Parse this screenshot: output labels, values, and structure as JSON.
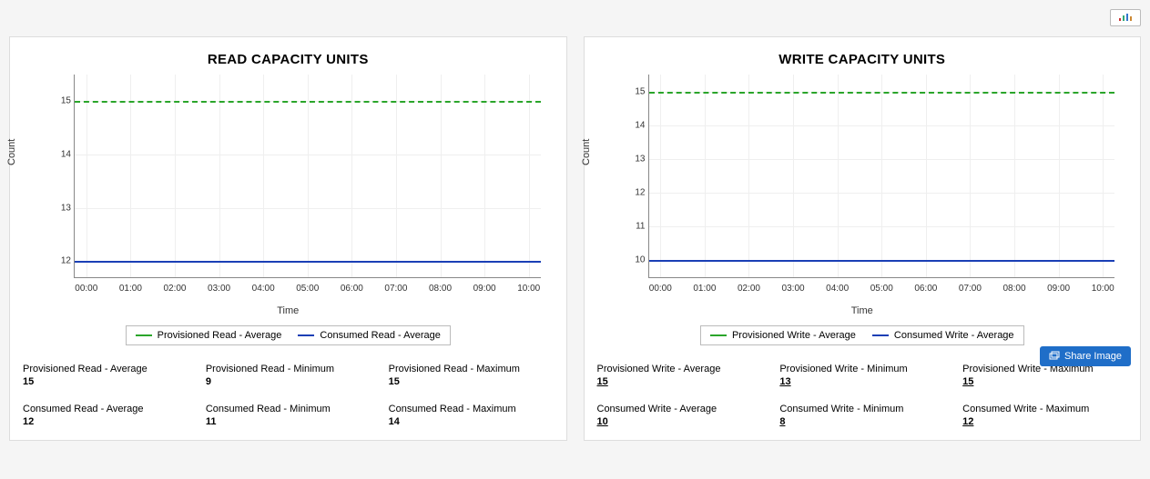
{
  "corner_icon_label": "chart-options",
  "share_button": "Share Image",
  "charts": [
    {
      "title": "READ CAPACITY UNITS",
      "xlabel": "Time",
      "ylabel": "Count",
      "legend": [
        {
          "color": "green",
          "label": "Provisioned Read - Average"
        },
        {
          "color": "blue",
          "label": "Consumed Read - Average"
        }
      ],
      "stats": [
        {
          "label": "Provisioned Read - Average",
          "value": "15"
        },
        {
          "label": "Provisioned Read - Minimum",
          "value": "9"
        },
        {
          "label": "Provisioned Read - Maximum",
          "value": "15"
        },
        {
          "label": "Consumed Read - Average",
          "value": "12"
        },
        {
          "label": "Consumed Read - Minimum",
          "value": "11"
        },
        {
          "label": "Consumed Read - Maximum",
          "value": "14"
        }
      ],
      "stats_underlined": false
    },
    {
      "title": "WRITE CAPACITY UNITS",
      "xlabel": "Time",
      "ylabel": "Count",
      "legend": [
        {
          "color": "green",
          "label": "Provisioned Write - Average"
        },
        {
          "color": "blue",
          "label": "Consumed Write - Average"
        }
      ],
      "stats": [
        {
          "label": "Provisioned Write - Average",
          "value": "15"
        },
        {
          "label": "Provisioned Write - Minimum",
          "value": "13"
        },
        {
          "label": "Provisioned Write - Maximum",
          "value": "15"
        },
        {
          "label": "Consumed Write - Average",
          "value": "10"
        },
        {
          "label": "Consumed Write - Minimum",
          "value": "8"
        },
        {
          "label": "Consumed Write - Maximum",
          "value": "12"
        }
      ],
      "stats_underlined": true,
      "has_share_button": true
    }
  ],
  "chart_data": [
    {
      "type": "line",
      "title": "READ CAPACITY UNITS",
      "xlabel": "Time",
      "ylabel": "Count",
      "y_ticks": [
        12,
        13,
        14,
        15
      ],
      "x_ticks": [
        "00:00",
        "01:00",
        "02:00",
        "03:00",
        "04:00",
        "05:00",
        "06:00",
        "07:00",
        "08:00",
        "09:00",
        "10:00"
      ],
      "ylim": [
        11.7,
        15.5
      ],
      "series": [
        {
          "name": "Provisioned Read - Average",
          "color": "#2aa52a",
          "style": "dashed",
          "constant_value": 15
        },
        {
          "name": "Consumed Read - Average",
          "color": "#1a3fb5",
          "style": "solid",
          "constant_value": 12
        }
      ]
    },
    {
      "type": "line",
      "title": "WRITE CAPACITY UNITS",
      "xlabel": "Time",
      "ylabel": "Count",
      "y_ticks": [
        10,
        11,
        12,
        13,
        14,
        15
      ],
      "x_ticks": [
        "00:00",
        "01:00",
        "02:00",
        "03:00",
        "04:00",
        "05:00",
        "06:00",
        "07:00",
        "08:00",
        "09:00",
        "10:00"
      ],
      "ylim": [
        9.5,
        15.5
      ],
      "series": [
        {
          "name": "Provisioned Write - Average",
          "color": "#2aa52a",
          "style": "dashed",
          "constant_value": 15
        },
        {
          "name": "Consumed Write - Average",
          "color": "#1a3fb5",
          "style": "solid",
          "constant_value": 10
        }
      ]
    }
  ]
}
